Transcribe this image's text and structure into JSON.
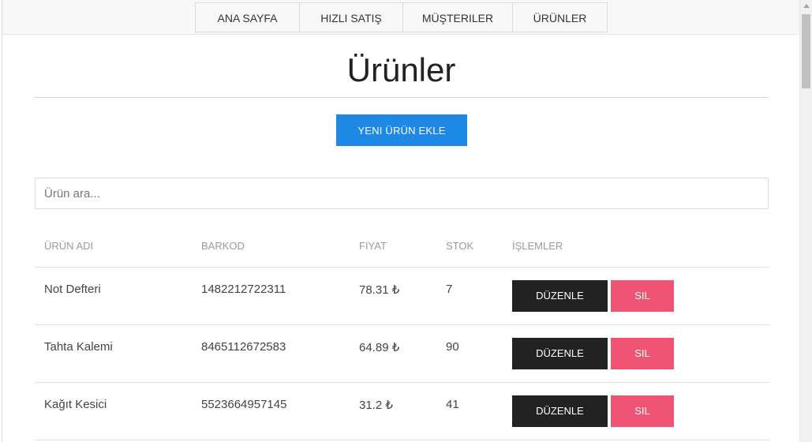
{
  "nav": {
    "items": [
      {
        "label": "ANA SAYFA"
      },
      {
        "label": "HIZLI SATIŞ"
      },
      {
        "label": "MÜŞTERILER"
      },
      {
        "label": "ÜRÜNLER"
      }
    ]
  },
  "page": {
    "title": "Ürünler",
    "add_button_label": "YENI ÜRÜN EKLE"
  },
  "search": {
    "placeholder": "Ürün ara...",
    "value": ""
  },
  "table": {
    "headers": {
      "name": "ÜRÜN ADI",
      "barcode": "BARKOD",
      "price": "FIYAT",
      "stock": "STOK",
      "actions": "İŞLEMLER"
    },
    "edit_label": "DÜZENLE",
    "delete_label": "SIL",
    "rows": [
      {
        "name": "Not Defteri",
        "barcode": "1482212722311",
        "price": "78.31 ₺",
        "stock": "7"
      },
      {
        "name": "Tahta Kalemi",
        "barcode": "8465112672583",
        "price": "64.89 ₺",
        "stock": "90"
      },
      {
        "name": "Kağıt Kesici",
        "barcode": "5523664957145",
        "price": "31.2 ₺",
        "stock": "41"
      }
    ]
  },
  "colors": {
    "primary": "#1e88e5",
    "edit": "#222222",
    "delete": "#f05474"
  }
}
